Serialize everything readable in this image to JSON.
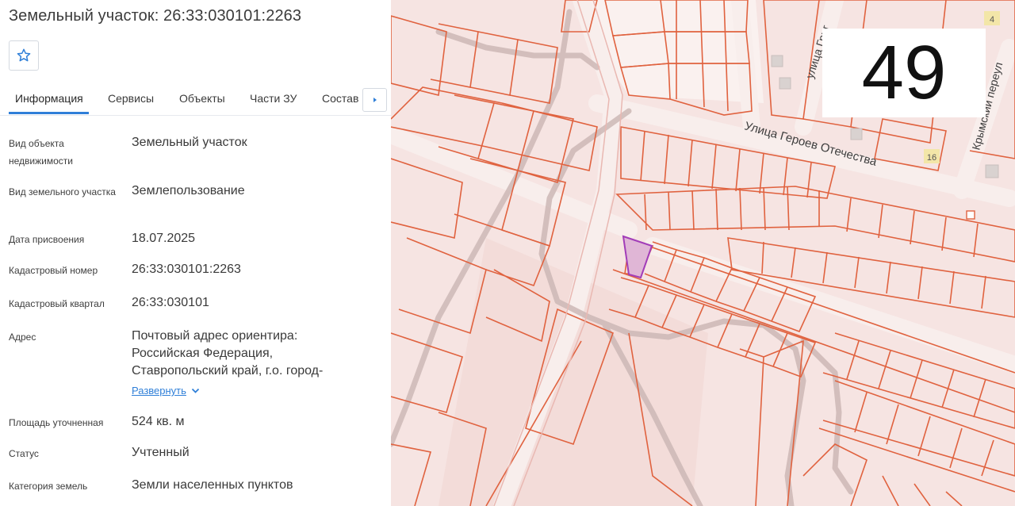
{
  "page": {
    "title": "Земельный участок: 26:33:030101:2263"
  },
  "favorite": {
    "icon": "star-icon"
  },
  "tabs": [
    {
      "label": "Информация",
      "active": true
    },
    {
      "label": "Сервисы"
    },
    {
      "label": "Объекты"
    },
    {
      "label": "Части ЗУ"
    },
    {
      "label": "Состав"
    }
  ],
  "tab_scroll": {
    "icon": "caret-right-icon"
  },
  "fields": [
    {
      "label": "Вид объекта недвижимости",
      "value": "Земельный участок"
    },
    {
      "label": "Вид земельного участка",
      "value": "Землепользование"
    },
    {
      "label": "Дата присвоения",
      "value": "18.07.2025"
    },
    {
      "label": "Кадастровый номер",
      "value": "26:33:030101:2263"
    },
    {
      "label": "Кадастровый квартал",
      "value": "26:33:030101"
    },
    {
      "label": "Адрес",
      "value": "Почтовый адрес ориентира: Российская Федерация, Ставропольский край, г.о. город-"
    },
    {
      "label": "Площадь уточненная",
      "value": "524 кв. м"
    },
    {
      "label": "Статус",
      "value": "Учтенный"
    },
    {
      "label": "Категория земель",
      "value": "Земли населенных пунктов"
    }
  ],
  "expand_link": {
    "label": "Развернуть",
    "icon": "chevron-down-icon"
  },
  "map": {
    "zoom_level": "49",
    "streets": [
      "Улица Героев Отечества",
      "улица Григ",
      "Крымский переул"
    ],
    "house_numbers": [
      "4",
      "16"
    ],
    "parcel_color": "#e05a3a",
    "selected_parcel_color": "#a23cb8"
  }
}
